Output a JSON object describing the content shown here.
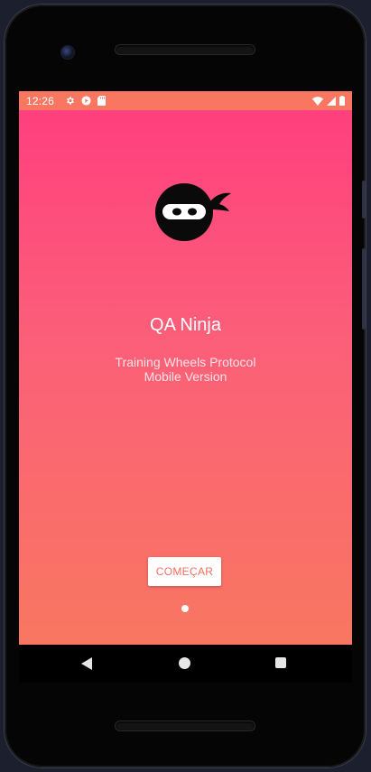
{
  "status_bar": {
    "time": "12:26",
    "left_icons": [
      "settings-icon",
      "play-icon",
      "sd-card-icon"
    ],
    "right_icons": [
      "wifi-icon",
      "signal-icon",
      "battery-icon"
    ]
  },
  "app": {
    "logo_icon": "ninja-head-icon",
    "title": "QA Ninja",
    "subtitle_line1": "Training Wheels Protocol",
    "subtitle_line2": "Mobile Version",
    "start_button_label": "COMEÇAR",
    "page_indicator": {
      "current": 1
    }
  },
  "navigation": {
    "buttons": [
      "back-icon",
      "home-icon",
      "recents-icon"
    ]
  },
  "colors": {
    "gradient_top": "#ff3d7f",
    "gradient_bottom": "#f97761",
    "status_bar": "#f97761",
    "button_text": "#f2705f"
  }
}
